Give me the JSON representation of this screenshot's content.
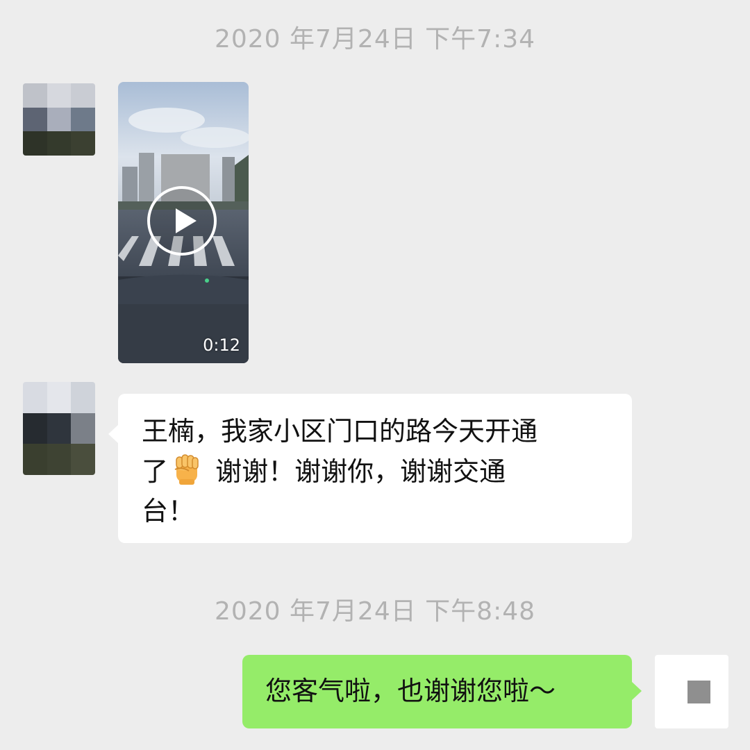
{
  "colors": {
    "background": "#ededed",
    "timestamp_text": "#b2b2b2",
    "incoming_bubble": "#ffffff",
    "outgoing_bubble": "#95ec69"
  },
  "messages": {
    "timestamp_1": "2020 年7月24日 下午7:34",
    "video": {
      "duration": "0:12",
      "icon": "play-icon"
    },
    "incoming_text": {
      "line_1": "王楠，我家小区门口的路今天开通",
      "line_2_before_emoji": "了",
      "emoji": "raised-fist-icon",
      "line_2_after_emoji": " 谢谢！谢谢你，谢谢交通",
      "line_3": "台！"
    },
    "timestamp_2": "2020 年7月24日 下午8:48",
    "outgoing_text": "您客气啦，也谢谢您啦～"
  }
}
